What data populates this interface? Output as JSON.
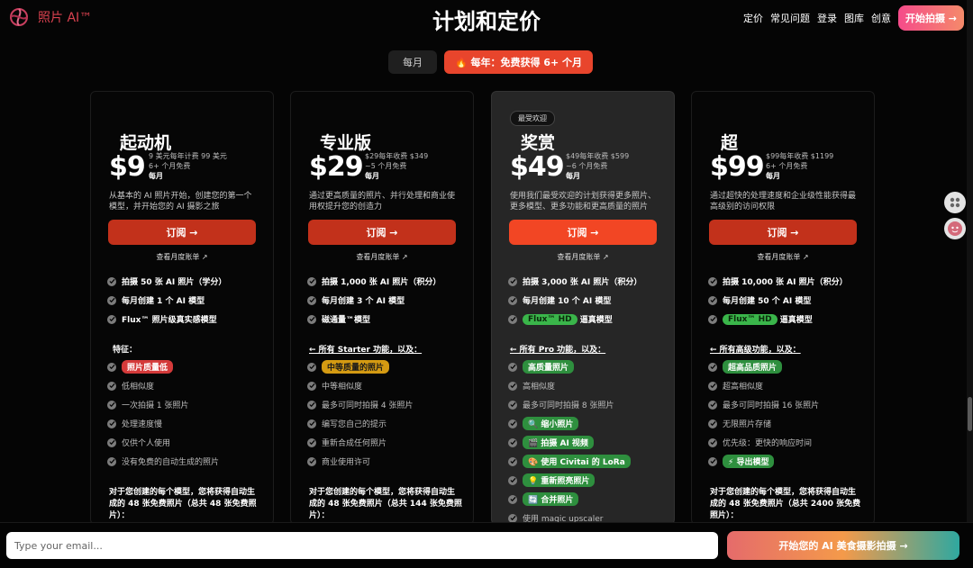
{
  "brand": {
    "name": "照片 AI™"
  },
  "header": {
    "title": "计划和定价"
  },
  "nav": {
    "items": [
      "定价",
      "常见问题",
      "登录",
      "图库",
      "创意"
    ],
    "cta": "开始拍摄 →"
  },
  "billing": {
    "monthly": "每月",
    "yearly": "🔥 每年：免费获得 6+ 个月"
  },
  "plans": [
    {
      "name": "起动机",
      "price": "$9",
      "note1": "9 美元每年计费 99 美元",
      "note2": "6+ 个月免费",
      "per": "每月",
      "desc": "从基本的 AI 照片开始，创建您的第一个模型，并开始您的 AI 摄影之旅",
      "subscribe": "订阅 →",
      "bill_link": "查看月度账单 ↗",
      "core": [
        "拍摄 50 张 AI 照片（学分）",
        "每月创建 1 个 AI 模型",
        "Flux™ 照片级真实感模型"
      ],
      "section": "特征：",
      "features": [
        {
          "text": "照片质量低",
          "pill": "red"
        },
        {
          "text": "低相似度"
        },
        {
          "text": "一次拍摄 1 张照片"
        },
        {
          "text": "处理速度慢"
        },
        {
          "text": "仅供个人使用"
        },
        {
          "text": "没有免费的自动生成的照片"
        }
      ],
      "footer": "对于您创建的每个模型，您将获得自动生成的 48 张免费照片（总共 48 张免费照片）："
    },
    {
      "name": "专业版",
      "price": "$29",
      "note1": "$29每年收费 $349",
      "note2": "~5 个月免费",
      "per": "每月",
      "desc": "通过更高质量的照片、并行处理和商业使用权提升您的创造力",
      "subscribe": "订阅 →",
      "bill_link": "查看月度账单 ↗",
      "core": [
        "拍摄 1,000 张 AI 照片（积分）",
        "每月创建 3 个 AI 模型",
        "磁通量™模型"
      ],
      "section": "← 所有 Starter 功能，以及：",
      "features": [
        {
          "text": "中等质量的照片",
          "pill": "yellow"
        },
        {
          "text": "中等相似度"
        },
        {
          "text": "最多可同时拍摄 4 张照片"
        },
        {
          "text": "编写您自己的提示"
        },
        {
          "text": "重新合成任何照片"
        },
        {
          "text": "商业使用许可"
        }
      ],
      "footer": "对于您创建的每个模型，您将获得自动生成的 48 张免费照片（总共 144 张免费照片）："
    },
    {
      "name": "奖赏",
      "badge": "最受欢迎",
      "price": "$49",
      "note1": "$49每年收费 $599",
      "note2": "~6 个月免费",
      "per": "每月",
      "desc": "使用我们最受欢迎的计划获得更多照片、更多模型、更多功能和更高质量的照片",
      "subscribe": "订阅 →",
      "bill_link": "查看月度账单 ↗",
      "core": [
        "拍摄 3,000 张 AI 照片（积分）",
        "每月创建 10 个 AI 模型",
        "逼真模型"
      ],
      "core_pill": "Flux™ HD",
      "section": "← 所有 Pro 功能，以及：",
      "features": [
        {
          "text": "高质量照片",
          "pill": "green"
        },
        {
          "text": "高相似度"
        },
        {
          "text": "最多可同时拍摄 8 张照片"
        },
        {
          "text": "🔍 缩小照片",
          "pill": "green"
        },
        {
          "text": "🎬 拍摄 AI 视频",
          "pill": "green"
        },
        {
          "text": "🎨 使用 Civitai 的 LoRa",
          "pill": "green"
        },
        {
          "text": "💡 重新照亮照片",
          "pill": "green"
        },
        {
          "text": "🔄 合并照片",
          "pill": "green"
        },
        {
          "text": "使用 magic upscaler"
        }
      ]
    },
    {
      "name": "超",
      "price": "$99",
      "note1": "$99每年收费 $1199",
      "note2": "6+ 个月免费",
      "per": "每月",
      "desc": "通过超快的处理速度和企业级性能获得最高级别的访问权限",
      "subscribe": "订阅 →",
      "bill_link": "查看月度账单 ↗",
      "core": [
        "拍摄 10,000 张 AI 照片（积分）",
        "每月创建 50 个 AI 模型",
        "逼真模型"
      ],
      "core_pill": "Flux™ HD",
      "section": "← 所有高级功能，以及：",
      "features": [
        {
          "text": "超高品质照片",
          "pill": "green"
        },
        {
          "text": "超高相似度"
        },
        {
          "text": "最多可同时拍摄 16 张照片"
        },
        {
          "text": "无限照片存储"
        },
        {
          "text": "优先级：更快的响应时间"
        },
        {
          "text": "⚡ 导出模型",
          "pill": "green"
        }
      ],
      "footer": "对于您创建的每个模型，您将获得自动生成的 48 张免费照片（总共 2400 张免费照片）："
    }
  ],
  "bottom": {
    "email_placeholder": "Type your email...",
    "cta": "开始您的 AI 美食摄影拍摄 →"
  },
  "colors": {
    "accent": "#e8452c",
    "button": "#c2311b",
    "featured_button": "#f24624",
    "brand": "#d9414f"
  }
}
